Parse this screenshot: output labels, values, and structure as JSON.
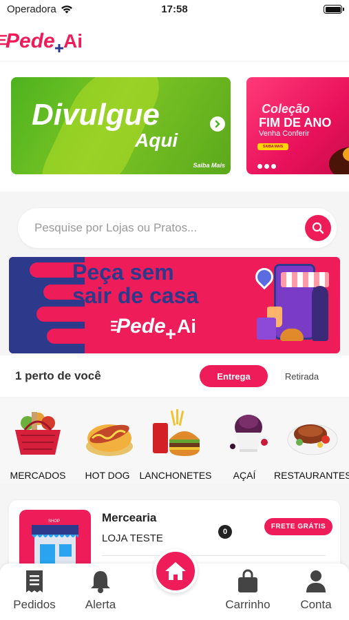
{
  "status_bar": {
    "carrier": "Operadora",
    "time": "17:58"
  },
  "header": {
    "logo_text": "Pede+Ai"
  },
  "promos": [
    {
      "title": "Divulgue",
      "subtitle": "Aqui",
      "cta": "Saiba Mais"
    },
    {
      "line1": "Coleção",
      "line2": "FIM DE ANO",
      "line3": "Venha Conferir",
      "button": "SAIBA MAIS"
    }
  ],
  "search": {
    "placeholder": "Pesquise por Lojas ou Pratos..."
  },
  "hero": {
    "line1": "Peça sem",
    "line2": "sair de casa",
    "logo_text": "Pede+Ai"
  },
  "near": {
    "title": "1 perto de você",
    "tabs": [
      {
        "label": "Entrega",
        "active": true
      },
      {
        "label": "Retirada",
        "active": false
      }
    ]
  },
  "categories": [
    {
      "label": "MERCADOS",
      "icon": "grocery-basket-icon"
    },
    {
      "label": "HOT DOG",
      "icon": "hot-dog-icon"
    },
    {
      "label": "LANCHONETES",
      "icon": "burger-icon"
    },
    {
      "label": "AÇAÍ",
      "icon": "acai-icon"
    },
    {
      "label": "RESTAURANTES",
      "icon": "restaurant-plate-icon"
    }
  ],
  "store": {
    "name": "Mercearia",
    "subtitle": "LOJA TESTE",
    "badge_count": "0",
    "shipping_label": "FRETE GRÁTIS"
  },
  "tabbar": [
    {
      "label": "Pedidos",
      "icon": "receipt-icon"
    },
    {
      "label": "Alerta",
      "icon": "bell-icon"
    },
    {
      "label": "",
      "icon": "home-icon"
    },
    {
      "label": "Carrinho",
      "icon": "shopping-bag-icon"
    },
    {
      "label": "Conta",
      "icon": "user-icon"
    }
  ],
  "colors": {
    "brand": "#ee1d5a",
    "navy": "#2d3a8c",
    "green": "#5ab51f"
  }
}
